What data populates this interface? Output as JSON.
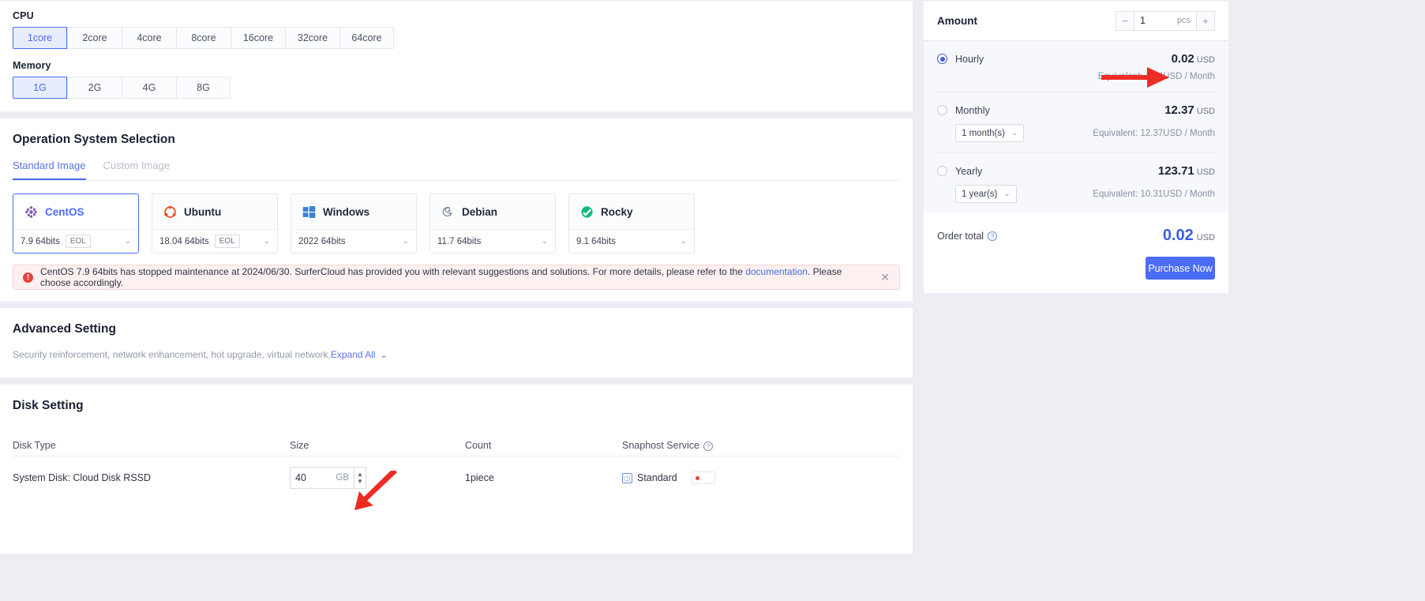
{
  "cpu": {
    "label": "CPU",
    "options": [
      "1core",
      "2core",
      "4core",
      "8core",
      "16core",
      "32core",
      "64core"
    ],
    "selected": "1core"
  },
  "memory": {
    "label": "Memory",
    "options": [
      "1G",
      "2G",
      "4G",
      "8G"
    ],
    "selected": "1G"
  },
  "os": {
    "title": "Operation System Selection",
    "tabs": [
      {
        "label": "Standard Image",
        "active": true
      },
      {
        "label": "Custom Image",
        "active": false
      }
    ],
    "items": [
      {
        "name": "CentOS",
        "icon": "centos-icon",
        "version": "7.9 64bits",
        "badge": "EOL",
        "selected": true
      },
      {
        "name": "Ubuntu",
        "icon": "ubuntu-icon",
        "version": "18.04 64bits",
        "badge": "EOL",
        "selected": false
      },
      {
        "name": "Windows",
        "icon": "windows-icon",
        "version": "2022 64bits",
        "badge": "",
        "selected": false
      },
      {
        "name": "Debian",
        "icon": "debian-icon",
        "version": "11.7 64bits",
        "badge": "",
        "selected": false
      },
      {
        "name": "Rocky",
        "icon": "rocky-icon",
        "version": "9.1 64bits",
        "badge": "",
        "selected": false
      }
    ]
  },
  "warning": {
    "text_before_link": "CentOS 7.9 64bits has stopped maintenance at 2024/06/30. SurferCloud has provided you with relevant suggestions and solutions. For more details, please refer to the ",
    "link_text": "documentation",
    "text_after_link": ". Please choose accordingly.",
    "close_icon": "close-icon"
  },
  "advanced": {
    "title": "Advanced Setting",
    "description": "Security reinforcement, network enhancement, hot upgrade, virtual network,",
    "expand_label": "Expand All",
    "chevron": "chevron-down-icon"
  },
  "disk": {
    "title": "Disk Setting",
    "headers": [
      "Disk Type",
      "Size",
      "Count",
      "Snaphost Service"
    ],
    "row": {
      "type": "System Disk: Cloud Disk RSSD",
      "size_value": "40",
      "size_unit": "GB",
      "count": "1piece",
      "snapshot_label": "Standard"
    }
  },
  "panel": {
    "amount_label": "Amount",
    "quantity": "1",
    "quantity_unit": "pcs",
    "decrease_label": "−",
    "increase_label": "+",
    "plans": [
      {
        "name": "Hourly",
        "price": "0.02",
        "currency": "USD",
        "equivalent": "Equivalent: 14.4USD / Month",
        "duration": "",
        "selected": true
      },
      {
        "name": "Monthly",
        "price": "12.37",
        "currency": "USD",
        "equivalent": "Equivalent: 12.37USD / Month",
        "duration": "1 month(s)",
        "selected": false
      },
      {
        "name": "Yearly",
        "price": "123.71",
        "currency": "USD",
        "equivalent": "Equivalent: 10.31USD / Month",
        "duration": "1 year(s)",
        "selected": false
      }
    ],
    "order_total_label": "Order total",
    "order_total_value": "0.02",
    "order_total_currency": "USD",
    "purchase_label": "Purchase Now"
  },
  "colors": {
    "accent": "#4a6cf7",
    "warning_bg": "#fdf0f0",
    "warning_icon": "#e8413b",
    "annotation_arrow": "#ee2b24"
  }
}
